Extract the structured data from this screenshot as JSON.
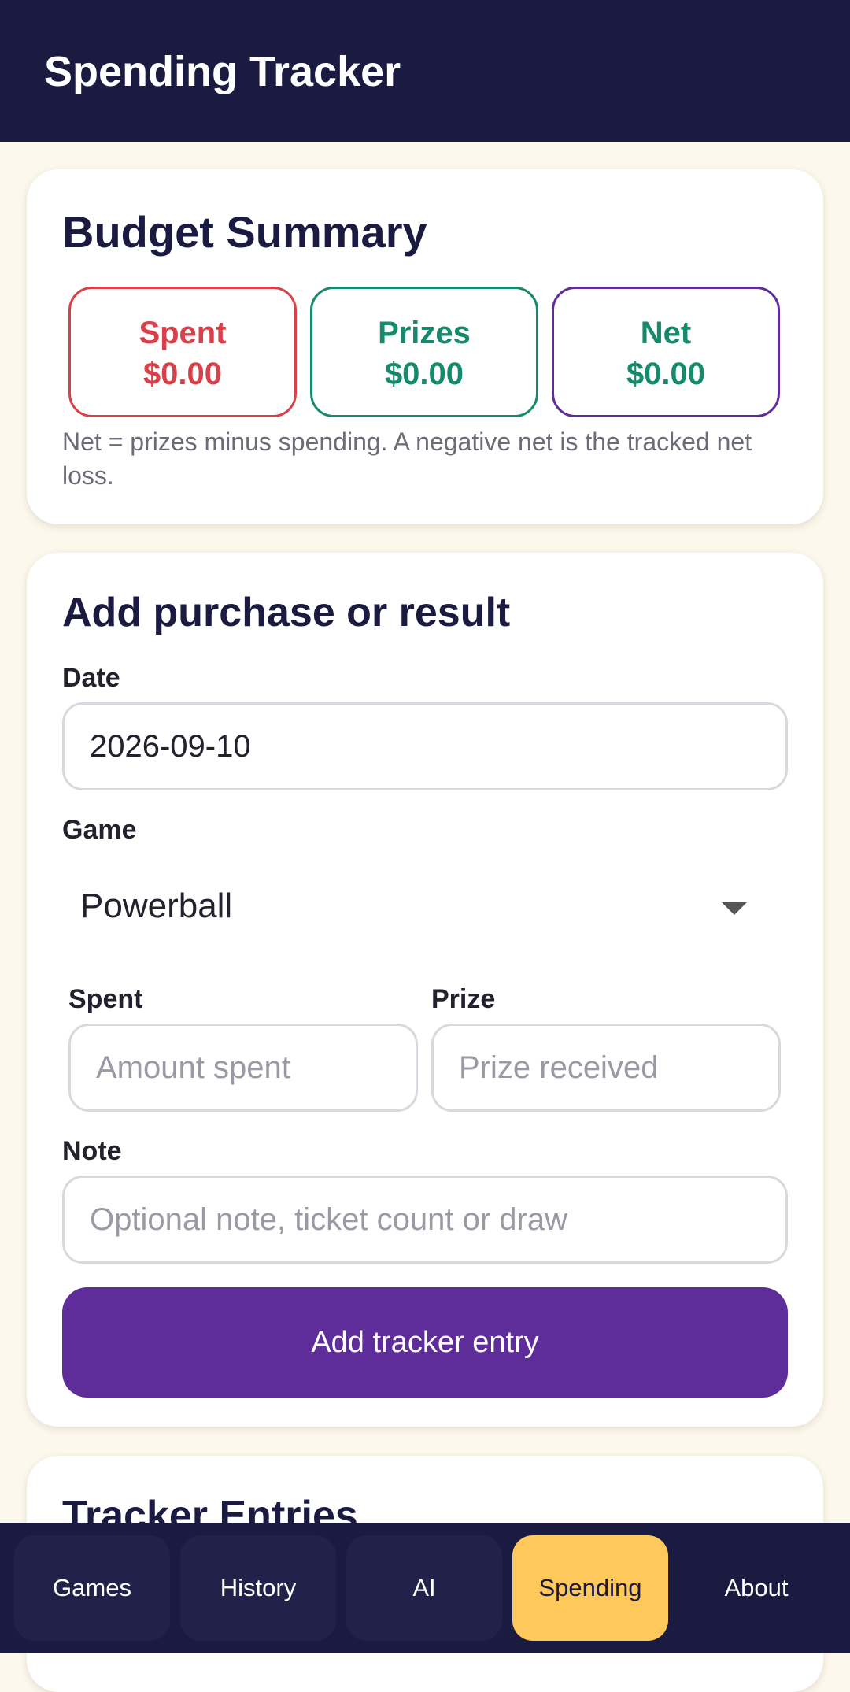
{
  "app_bar": {
    "title": "Spending Tracker"
  },
  "budget_summary": {
    "title": "Budget Summary",
    "spent": {
      "label": "Spent",
      "value": "$0.00",
      "color": "#d9414a"
    },
    "prizes": {
      "label": "Prizes",
      "value": "$0.00",
      "color": "#168a6c"
    },
    "net": {
      "label": "Net",
      "value": "$0.00",
      "color": "#168a6c",
      "border_color": "#5e2d9a"
    },
    "hint": "Net = prizes minus spending. A negative net is the tracked net loss."
  },
  "add_entry": {
    "title": "Add purchase or result",
    "date_label": "Date",
    "date_value": "2026-09-10",
    "game_label": "Game",
    "game_value": "Powerball",
    "spent_label": "Spent",
    "spent_placeholder": "Amount spent",
    "prize_label": "Prize",
    "prize_placeholder": "Prize received",
    "note_label": "Note",
    "note_placeholder": "Optional note, ticket count or draw",
    "submit_label": "Add tracker entry"
  },
  "tracker_entries": {
    "title": "Tracker Entries"
  },
  "bottom_nav": {
    "items": [
      {
        "label": "Games"
      },
      {
        "label": "History"
      },
      {
        "label": "AI"
      },
      {
        "label": "Spending",
        "active": true
      },
      {
        "label": "About"
      }
    ]
  },
  "colors": {
    "primary_dark": "#1b1a40",
    "accent_purple": "#5e2d9a",
    "active_tab": "#fec85b",
    "background": "#fdf8ec"
  }
}
